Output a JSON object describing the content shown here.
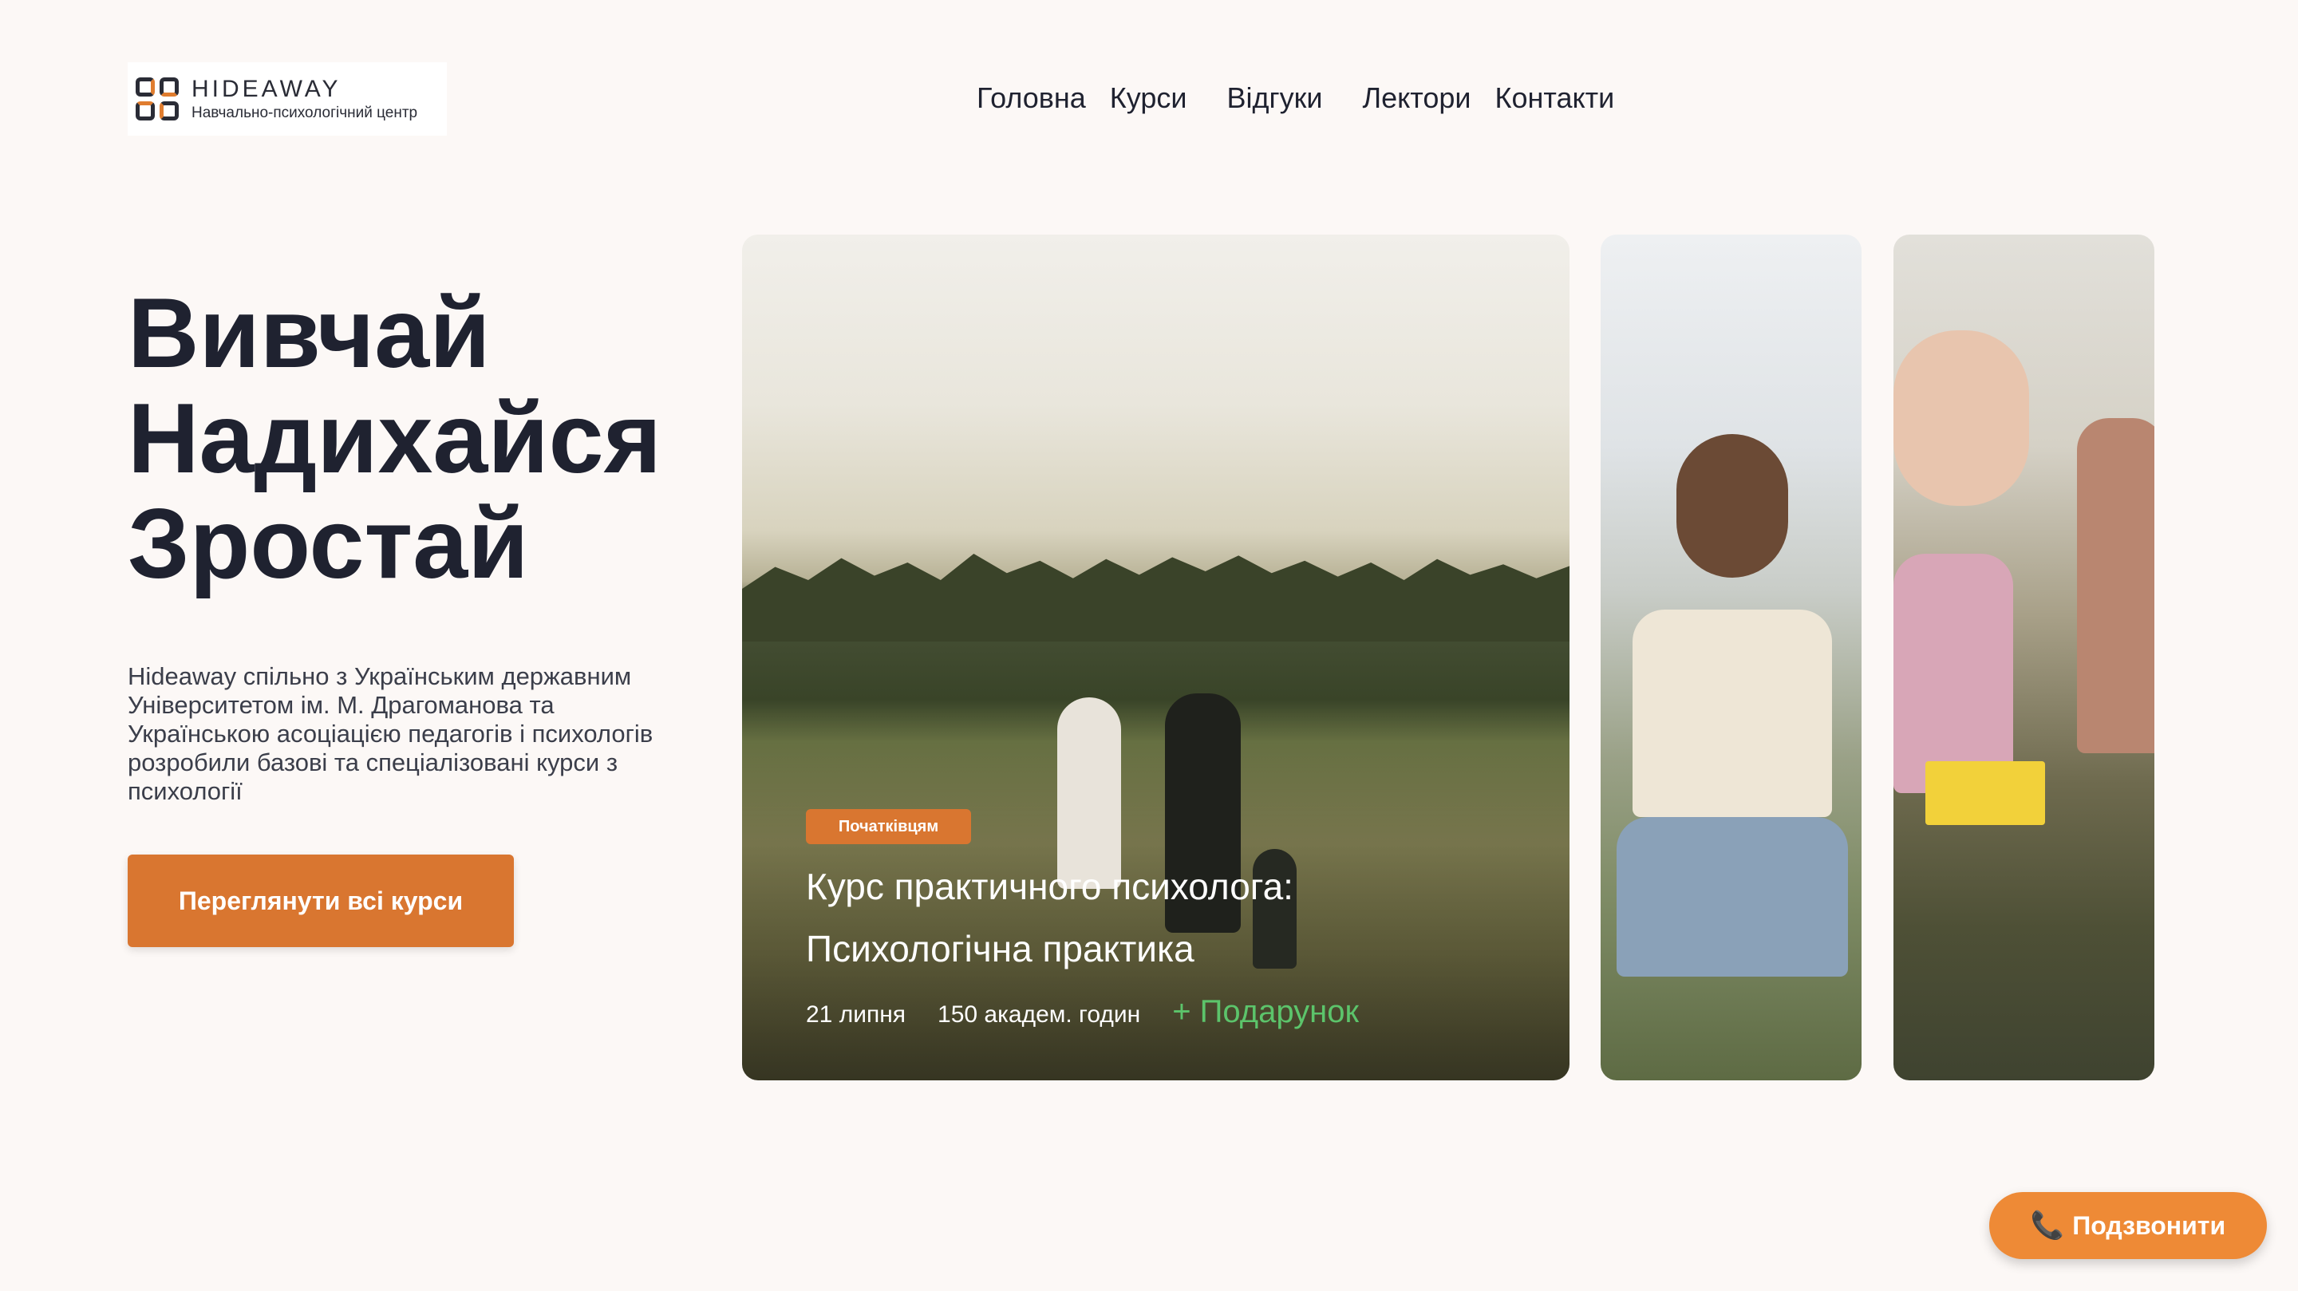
{
  "logo": {
    "title": "HIDEAWAY",
    "subtitle": "Навчально-психологічний центр"
  },
  "nav": {
    "items": [
      "Головна",
      "Курси",
      "Відгуки",
      "Лектори",
      "Контакти"
    ]
  },
  "hero": {
    "title_lines": [
      "Вивчай",
      "Надихайся",
      "Зростай"
    ],
    "description": "Hideaway спільно з Українським державним Університетом ім. М. Драгоманова та Українською асоціацією педагогів і психологів розробили базові та спеціалізовані курси з психології",
    "cta_label": "Переглянути всі курси"
  },
  "featured_course": {
    "badge": "Початківцям",
    "title": "Курс практичного психолога: Психологічна практика",
    "date": "21 липня",
    "hours": "150 академ. годин",
    "bonus": "+ Подарунок"
  },
  "callback": {
    "icon": "phone-icon",
    "label": "Подзвонити"
  },
  "colors": {
    "accent": "#d97630",
    "background": "#fcf8f6",
    "gift": "#5cc46b",
    "text": "#1f2230"
  }
}
